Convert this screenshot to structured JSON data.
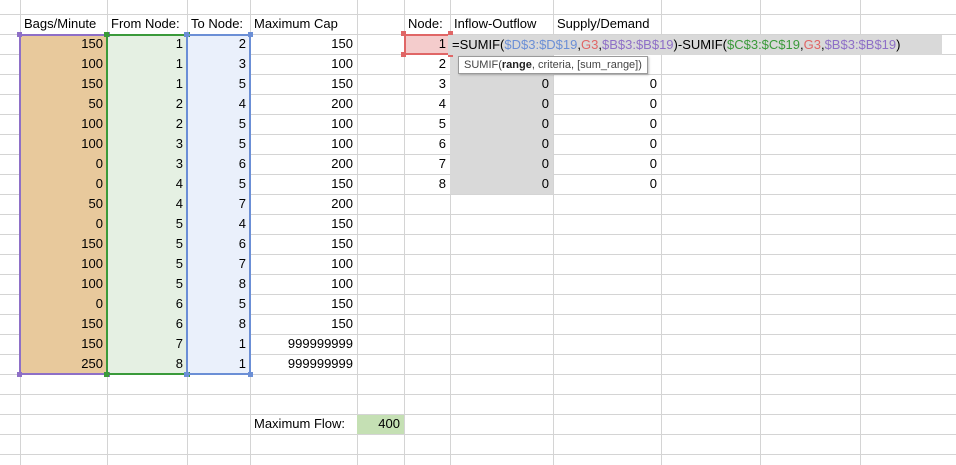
{
  "headers": {
    "bags": "Bags/Minute",
    "from": "From Node:",
    "to": "To Node:",
    "cap": "Maximum Cap",
    "node": "Node:",
    "flow": "Inflow-Outflow",
    "supply": "Supply/Demand"
  },
  "edges": [
    {
      "bags": "150",
      "from": "1",
      "to": "2",
      "cap": "150"
    },
    {
      "bags": "100",
      "from": "1",
      "to": "3",
      "cap": "100"
    },
    {
      "bags": "150",
      "from": "1",
      "to": "5",
      "cap": "150"
    },
    {
      "bags": "50",
      "from": "2",
      "to": "4",
      "cap": "200"
    },
    {
      "bags": "100",
      "from": "2",
      "to": "5",
      "cap": "100"
    },
    {
      "bags": "100",
      "from": "3",
      "to": "5",
      "cap": "100"
    },
    {
      "bags": "0",
      "from": "3",
      "to": "6",
      "cap": "200"
    },
    {
      "bags": "0",
      "from": "4",
      "to": "5",
      "cap": "150"
    },
    {
      "bags": "50",
      "from": "4",
      "to": "7",
      "cap": "200"
    },
    {
      "bags": "0",
      "from": "5",
      "to": "4",
      "cap": "150"
    },
    {
      "bags": "150",
      "from": "5",
      "to": "6",
      "cap": "150"
    },
    {
      "bags": "100",
      "from": "5",
      "to": "7",
      "cap": "100"
    },
    {
      "bags": "100",
      "from": "5",
      "to": "8",
      "cap": "100"
    },
    {
      "bags": "0",
      "from": "6",
      "to": "5",
      "cap": "150"
    },
    {
      "bags": "150",
      "from": "6",
      "to": "8",
      "cap": "150"
    },
    {
      "bags": "150",
      "from": "7",
      "to": "1",
      "cap": "999999999"
    },
    {
      "bags": "250",
      "from": "8",
      "to": "1",
      "cap": "999999999"
    }
  ],
  "nodes": [
    {
      "node": "1",
      "flow": "",
      "supply": ""
    },
    {
      "node": "2",
      "flow": "",
      "supply": ""
    },
    {
      "node": "3",
      "flow": "0",
      "supply": "0"
    },
    {
      "node": "4",
      "flow": "0",
      "supply": "0"
    },
    {
      "node": "5",
      "flow": "0",
      "supply": "0"
    },
    {
      "node": "6",
      "flow": "0",
      "supply": "0"
    },
    {
      "node": "7",
      "flow": "0",
      "supply": "0"
    },
    {
      "node": "8",
      "flow": "0",
      "supply": "0"
    }
  ],
  "formula": {
    "tokens": [
      {
        "text": "=SUMIF(",
        "color": "#000000"
      },
      {
        "text": "$D$3:$D$19",
        "color": "#6b8fd6"
      },
      {
        "text": ",",
        "color": "#000000"
      },
      {
        "text": "G3",
        "color": "#e06666"
      },
      {
        "text": ",",
        "color": "#000000"
      },
      {
        "text": "$B$3:$B$19",
        "color": "#8e6fc7"
      },
      {
        "text": ")-SUMIF(",
        "color": "#000000"
      },
      {
        "text": "$C$3:$C$19",
        "color": "#3a9a3a"
      },
      {
        "text": ",",
        "color": "#000000"
      },
      {
        "text": "G3",
        "color": "#e06666"
      },
      {
        "text": ",",
        "color": "#000000"
      },
      {
        "text": "$B$3:$B$19",
        "color": "#8e6fc7"
      },
      {
        "text": ")",
        "color": "#000000"
      }
    ]
  },
  "tooltip": {
    "fn": "SUMIF(",
    "arg1": "range",
    "rest": ", criteria, [sum_range])"
  },
  "max_flow": {
    "label": "Maximum Flow:",
    "value": "400"
  },
  "colors": {
    "bags_fill": "#e8c99c",
    "from_fill": "#e5f0e3",
    "to_fill": "#eaf0fb",
    "flow_fill": "#d9d9d9",
    "maxflow_fill": "#c5e0b4",
    "selected_fill": "#f4cccc",
    "bags_border": "#8e6fc7",
    "from_border": "#3a9a3a",
    "to_border": "#6b8fd6",
    "selected_border": "#e06666",
    "gridline": "#d4d4d4"
  }
}
